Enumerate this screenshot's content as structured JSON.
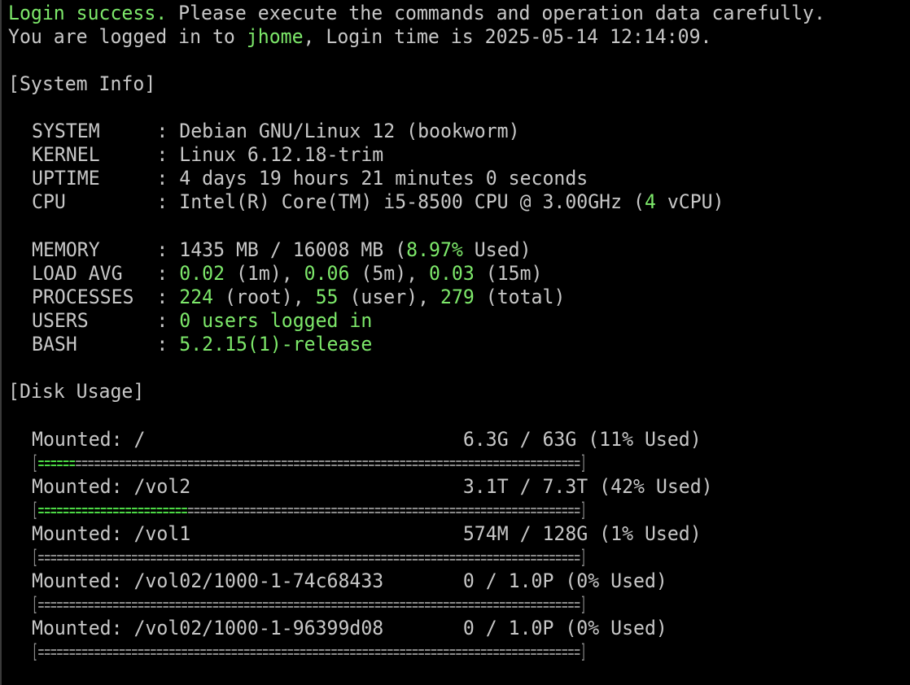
{
  "window": {
    "app": "terminal"
  },
  "login": {
    "line1_success": "Login success.",
    "line1_rest": " Please execute the commands and operation data carefully.",
    "line2_prefix": "You are logged in to ",
    "hostname": "jhome",
    "line2_suffix": ", Login time is 2025-05-14 12:14:09."
  },
  "system_info": {
    "header": "[System Info]",
    "system": {
      "key": "SYSTEM     : ",
      "value": "Debian GNU/Linux 12 (bookworm)"
    },
    "kernel": {
      "key": "KERNEL     : ",
      "value": "Linux 6.12.18-trim"
    },
    "uptime": {
      "key": "UPTIME     : ",
      "value": "4 days 19 hours 21 minutes 0 seconds"
    },
    "cpu": {
      "key": "CPU        : ",
      "pre": "Intel(R) Core(TM) i5-8500 CPU @ 3.00GHz (",
      "vcpu_count": "4",
      "post": " vCPU)"
    },
    "memory": {
      "key": "MEMORY     : ",
      "pre": "1435 MB / 16008 MB (",
      "percent": "8.97%",
      "post": " Used)"
    },
    "load_avg": {
      "key": "LOAD AVG   : ",
      "v1": "0.02",
      "l1": " (1m), ",
      "v5": "0.06",
      "l5": " (5m), ",
      "v15": "0.03",
      "l15": " (15m)"
    },
    "processes": {
      "key": "PROCESSES  : ",
      "root": "224",
      "root_label": " (root), ",
      "user": "55",
      "user_label": " (user), ",
      "total": "279",
      "total_label": " (total)"
    },
    "users": {
      "key": "USERS      : ",
      "count": "0",
      "rest": " users logged in"
    },
    "bash": {
      "key": "BASH       : ",
      "value": "5.2.15(1)-release"
    }
  },
  "disk_usage": {
    "header": "[Disk Usage]",
    "mounts": [
      {
        "label": "Mounted: /                            ",
        "usage": "6.3G / 63G (11% Used)",
        "fill": "======",
        "rest": "=================================================================================",
        "fraction": 0.11,
        "open": "[",
        "close": "]"
      },
      {
        "label": "Mounted: /vol2                        ",
        "usage": "3.1T / 7.3T (42% Used)",
        "fill": "========================",
        "rest": "===============================================================",
        "fraction": 0.42,
        "open": "[",
        "close": "]"
      },
      {
        "label": "Mounted: /vol1                        ",
        "usage": "574M / 128G (1% Used)",
        "fill": "",
        "rest": "=======================================================================================",
        "fraction": 0.01,
        "open": "[",
        "close": "]"
      },
      {
        "label": "Mounted: /vol02/1000-1-74c68433       ",
        "usage": "0 / 1.0P (0% Used)",
        "fill": "",
        "rest": "=======================================================================================",
        "fraction": 0.0,
        "open": "[",
        "close": "]"
      },
      {
        "label": "Mounted: /vol02/1000-1-96399d08       ",
        "usage": "0 / 1.0P (0% Used)",
        "fill": "",
        "rest": "=======================================================================================",
        "fraction": 0.0,
        "open": "[",
        "close": "]"
      }
    ]
  }
}
